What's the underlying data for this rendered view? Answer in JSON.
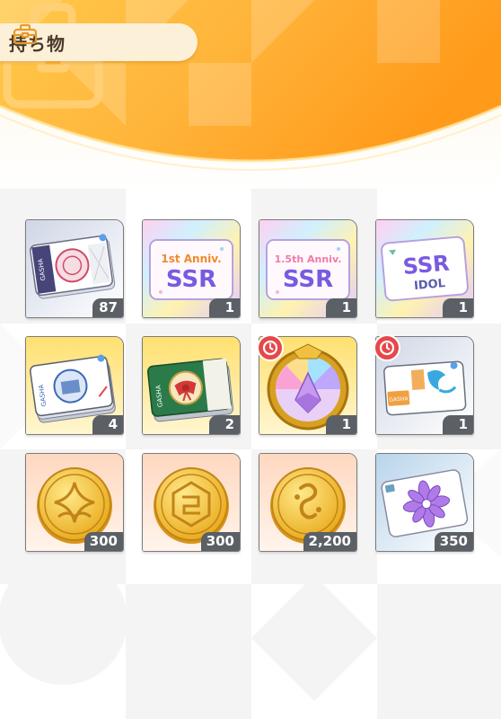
{
  "header": {
    "title": "持ち物",
    "title_icon": "bag-icon",
    "bg_color_light": "#ffc94a",
    "bg_color_dark": "#ff9a1a"
  },
  "items": [
    {
      "name": "gasha-ticket-pink",
      "count": "87",
      "icon": "gasha-ticket-icon"
    },
    {
      "name": "1st-anniv-ssr-ticket",
      "count": "1",
      "label_line1": "1st Anniv.",
      "label_line2": "SSR",
      "icon": "ssr-ticket-icon"
    },
    {
      "name": "1-5th-anniv-ssr-ticket",
      "count": "1",
      "label_line1": "1.5th Anniv.",
      "label_line2": "SSR",
      "icon": "ssr-ticket-icon"
    },
    {
      "name": "ssr-idol-ticket",
      "count": "1",
      "label_line1": "SSR",
      "label_line2": "IDOL",
      "icon": "ssr-idol-ticket-icon"
    },
    {
      "name": "gasha-ticket-blue",
      "count": "4",
      "icon": "gasha-ticket-icon"
    },
    {
      "name": "christmas-gasha-ticket",
      "count": "2",
      "icon": "christmas-ticket-icon"
    },
    {
      "name": "rainbow-gem-medal",
      "count": "1",
      "icon": "gem-medal-icon",
      "badge": "clock-icon"
    },
    {
      "name": "summer-gasha-ticket",
      "count": "1",
      "icon": "summer-ticket-icon",
      "badge": "clock-icon"
    },
    {
      "name": "gold-coin-sparkle",
      "count": "300",
      "icon": "gold-coin-icon"
    },
    {
      "name": "gold-coin-hexagon",
      "count": "300",
      "icon": "gold-coin-icon"
    },
    {
      "name": "gold-coin-note",
      "count": "2,200",
      "icon": "gold-coin-icon"
    },
    {
      "name": "flower-card",
      "count": "350",
      "icon": "flower-card-icon"
    }
  ],
  "colors": {
    "count_bg": "#5b5f66",
    "badge_bg": "#e6484a",
    "coin_gold": "#f5c32c",
    "frame_border": "#7b7b7b"
  }
}
